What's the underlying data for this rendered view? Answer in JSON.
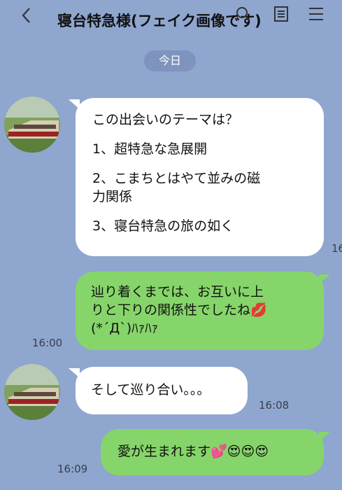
{
  "header": {
    "title": "寝台特急様(フェイク画像です)",
    "icons": {
      "back": "back-chevron-icon",
      "search": "search-icon",
      "notes": "notes-icon",
      "menu": "menu-icon"
    }
  },
  "date_label": "今日",
  "messages": [
    {
      "side": "left",
      "lines": [
        "この出会いのテーマは？",
        "1、超特急な急展開",
        "2、こまちとはやて並みの磁",
        "力関係",
        "3、寝台特急の旅の如く"
      ],
      "time": "16"
    },
    {
      "side": "right",
      "lines": [
        "辿り着くまでは、お互いに上",
        "りと下りの関係性でしたね💋",
        "(*´Д`)ﾊｧﾊｧ"
      ],
      "time": "16:00"
    },
    {
      "side": "left",
      "lines": [
        "そして巡り合い。。。"
      ],
      "time": "16:08"
    },
    {
      "side": "right",
      "lines": [
        "愛が生まれます💕😍😍😍"
      ],
      "time": "16:09"
    }
  ],
  "colors": {
    "background": "#8fa6cf",
    "sent_bubble": "#86d56a",
    "received_bubble": "#ffffff",
    "date_pill": "#7e93bd"
  }
}
